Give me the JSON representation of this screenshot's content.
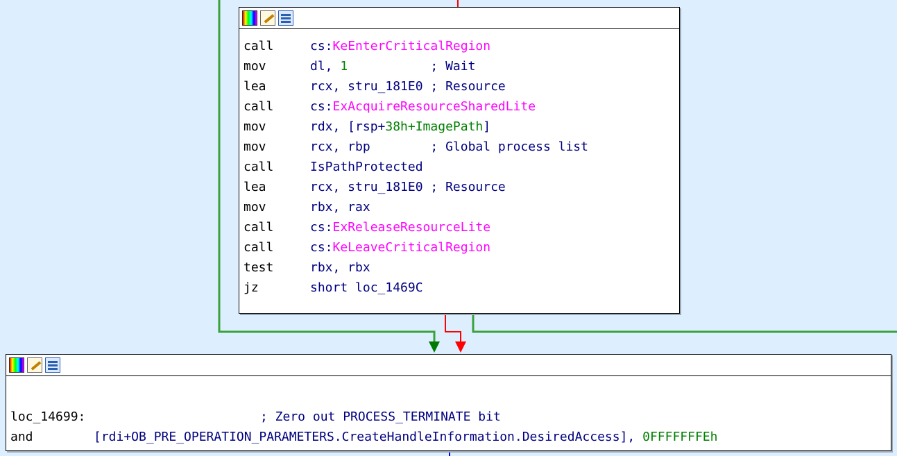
{
  "colors": {
    "background": "#ddeeff",
    "edge_green": "#3aa23a",
    "edge_red": "#ff0000",
    "edge_blue": "#0000ff",
    "import_function": "#ff00ff",
    "number": "#008000",
    "comment": "#000080"
  },
  "top_block": {
    "icons": [
      "color-palette-icon",
      "edit-pencil-icon",
      "graph-view-icon"
    ],
    "lines": [
      {
        "mnemonic": "call",
        "operand_prefix": "cs:",
        "operand_fn": "KeEnterCriticalRegion",
        "operand_rest": "",
        "comment": ""
      },
      {
        "mnemonic": "mov",
        "operand_prefix": "dl, ",
        "operand_num": "1",
        "operand_rest": "           ",
        "comment": "; Wait"
      },
      {
        "mnemonic": "lea",
        "operand_prefix": "rcx, stru_181E0 ",
        "operand_rest": "",
        "comment": "; Resource"
      },
      {
        "mnemonic": "call",
        "operand_prefix": "cs:",
        "operand_fn": "ExAcquireResourceSharedLite",
        "operand_rest": "",
        "comment": ""
      },
      {
        "mnemonic": "mov",
        "operand_prefix": "rdx, [rsp+",
        "operand_num": "38h+ImagePath",
        "operand_rest": "]",
        "comment": ""
      },
      {
        "mnemonic": "mov",
        "operand_prefix": "rcx, rbp        ",
        "operand_rest": "",
        "comment": "; Global process list"
      },
      {
        "mnemonic": "call",
        "operand_prefix": "IsPathProtected",
        "operand_rest": "",
        "comment": ""
      },
      {
        "mnemonic": "lea",
        "operand_prefix": "rcx, stru_181E0 ",
        "operand_rest": "",
        "comment": "; Resource"
      },
      {
        "mnemonic": "mov",
        "operand_prefix": "rbx, rax",
        "operand_rest": "",
        "comment": ""
      },
      {
        "mnemonic": "call",
        "operand_prefix": "cs:",
        "operand_fn": "ExReleaseResourceLite",
        "operand_rest": "",
        "comment": ""
      },
      {
        "mnemonic": "call",
        "operand_prefix": "cs:",
        "operand_fn": "KeLeaveCriticalRegion",
        "operand_rest": "",
        "comment": ""
      },
      {
        "mnemonic": "test",
        "operand_prefix": "rbx, rbx",
        "operand_rest": "",
        "comment": ""
      },
      {
        "mnemonic": "jz",
        "operand_prefix": "short loc_1469C",
        "operand_rest": "",
        "comment": ""
      }
    ]
  },
  "bottom_block": {
    "icons": [
      "color-palette-icon",
      "edit-pencil-icon",
      "graph-view-icon"
    ],
    "label": "loc_14699:",
    "label_comment": "; Zero out PROCESS_TERMINATE bit",
    "and_mnemonic": "and",
    "and_operand": "[rdi+OB_PRE_OPERATION_PARAMETERS.CreateHandleInformation.DesiredAccess], ",
    "and_imm": "0FFFFFFFEh"
  }
}
